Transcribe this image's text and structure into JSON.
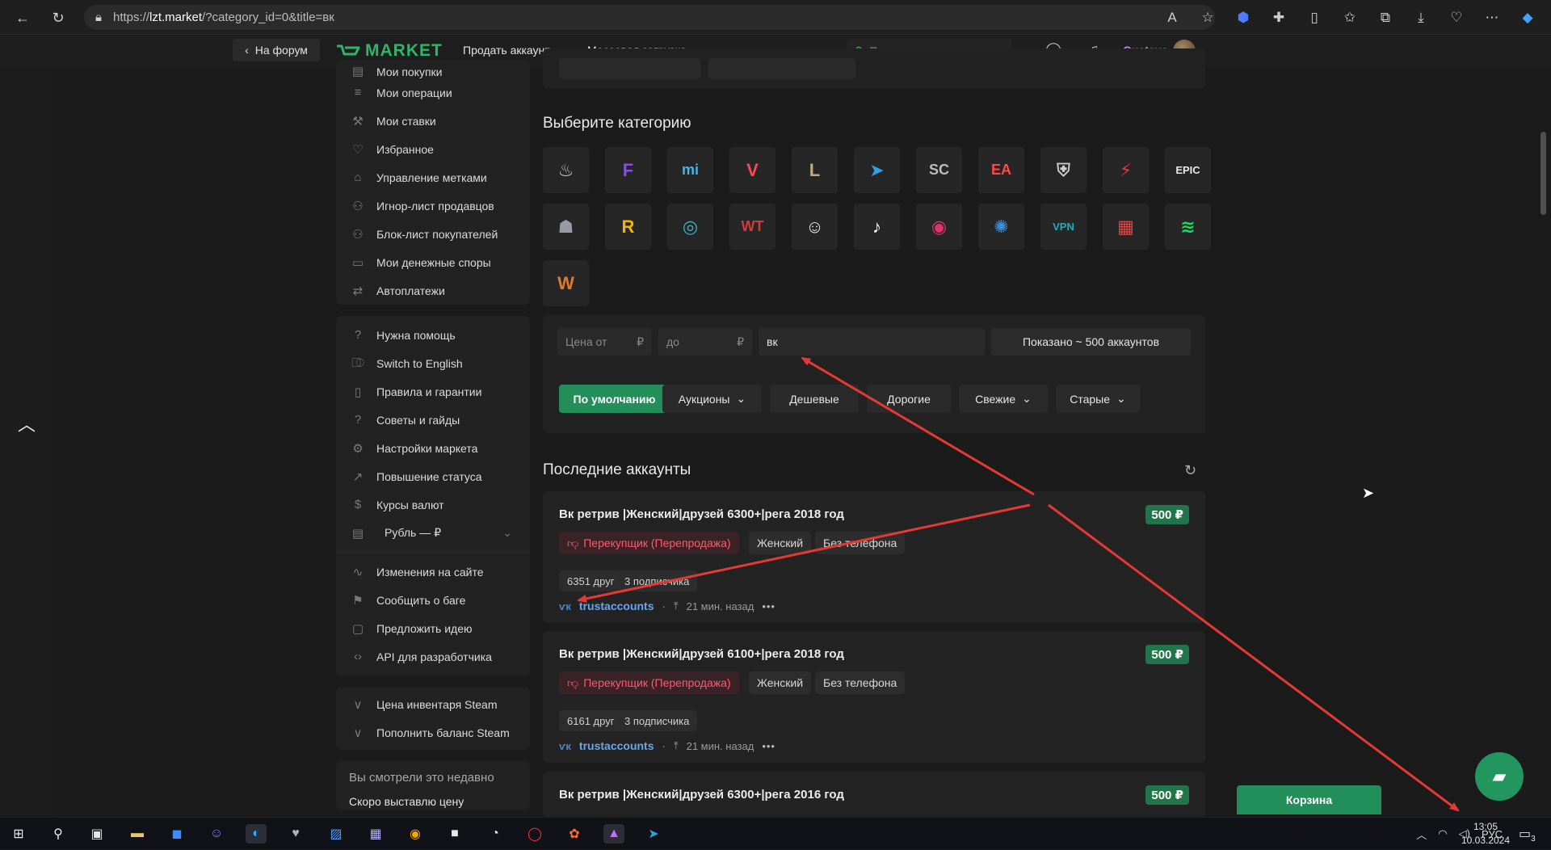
{
  "browser": {
    "url_prefix": "https://",
    "url_host": "lzt.market",
    "url_path": "/?category_id=0&title=вк"
  },
  "header": {
    "back_label": "На форум",
    "logo_text": "MARKET",
    "sell_label": "Продать аккаунт",
    "bulk_label": "Массовая загрузка",
    "search_placeholder": "Поиск...",
    "username": "Gustavo"
  },
  "sidebar": {
    "group1": [
      {
        "label": "Мои покупки",
        "icon": "bag-icon"
      },
      {
        "label": "Мои операции",
        "icon": "list-icon"
      },
      {
        "label": "Мои ставки",
        "icon": "gavel-icon"
      },
      {
        "label": "Избранное",
        "icon": "heart-icon"
      },
      {
        "label": "Управление метками",
        "icon": "tag-icon"
      },
      {
        "label": "Игнор-лист продавцов",
        "icon": "user-x-icon"
      },
      {
        "label": "Блок-лист покупателей",
        "icon": "user-block-icon"
      },
      {
        "label": "Мои денежные споры",
        "icon": "chat-icon"
      },
      {
        "label": "Автоплатежи",
        "icon": "repeat-icon"
      }
    ],
    "group2": [
      {
        "label": "Нужна помощь",
        "icon": "help-icon"
      },
      {
        "label": "Switch to English",
        "icon": "translate-icon"
      },
      {
        "label": "Правила и гарантии",
        "icon": "book-icon"
      },
      {
        "label": "Советы и гайды",
        "icon": "help-icon"
      },
      {
        "label": "Настройки маркета",
        "icon": "gear-icon"
      },
      {
        "label": "Повышение статуса",
        "icon": "trend-icon"
      },
      {
        "label": "Курсы валют",
        "icon": "dollar-icon"
      }
    ],
    "currency_label": "Рубль — ₽",
    "group3": [
      {
        "label": "Изменения на сайте",
        "icon": "pulse-icon"
      },
      {
        "label": "Сообщить о баге",
        "icon": "flag-icon"
      },
      {
        "label": "Предложить идею",
        "icon": "comment-icon"
      },
      {
        "label": "API для разработчика",
        "icon": "code-icon"
      }
    ],
    "group4": [
      {
        "label": "Цена инвентаря Steam",
        "icon": "steam-icon"
      },
      {
        "label": "Пополнить баланс Steam",
        "icon": "steam-icon"
      }
    ],
    "recent_heading": "Вы смотрели это недавно",
    "recent_item": "Скоро выставлю цену"
  },
  "categories": {
    "title": "Выберите категорию",
    "items": [
      {
        "name": "steam",
        "glyph": "♨",
        "color": "#c7c7c7"
      },
      {
        "name": "fortnite",
        "glyph": "F",
        "color": "#8b4fd6"
      },
      {
        "name": "mihoyo",
        "glyph": "mi",
        "color": "#3fb7e8"
      },
      {
        "name": "valorant",
        "glyph": "V",
        "color": "#ff4655"
      },
      {
        "name": "league-of-legends",
        "glyph": "L",
        "color": "#c8aa6e"
      },
      {
        "name": "telegram",
        "glyph": "➤",
        "color": "#2aa3e0"
      },
      {
        "name": "supercell",
        "glyph": "SC",
        "color": "#bdbdbd"
      },
      {
        "name": "ea",
        "glyph": "EA",
        "color": "#ff4747"
      },
      {
        "name": "world-of-tanks",
        "glyph": "⛨",
        "color": "#cfcfcf"
      },
      {
        "name": "wot-blitz",
        "glyph": "⚡",
        "color": "#e0394a"
      },
      {
        "name": "epic-games",
        "glyph": "EPIC",
        "color": "#e8e8e8"
      },
      {
        "name": "escape-from-tarkov",
        "glyph": "☗",
        "color": "#9a9aa6"
      },
      {
        "name": "rockstar",
        "glyph": "R",
        "color": "#f4b400"
      },
      {
        "name": "uplay",
        "glyph": "◎",
        "color": "#39b3c8"
      },
      {
        "name": "war-thunder",
        "glyph": "WT",
        "color": "#d33b3b"
      },
      {
        "name": "discord",
        "glyph": "☺",
        "color": "#e8e8e8"
      },
      {
        "name": "tiktok",
        "glyph": "♪",
        "color": "#ffffff"
      },
      {
        "name": "instagram",
        "glyph": "◉",
        "color": "#e1306c"
      },
      {
        "name": "chatgpt",
        "glyph": "✺",
        "color": "#3a8ed8"
      },
      {
        "name": "vpn",
        "glyph": "VPN",
        "color": "#2aa8b8"
      },
      {
        "name": "cinema",
        "glyph": "▦",
        "color": "#e04848"
      },
      {
        "name": "spotify",
        "glyph": "≋",
        "color": "#1ed760"
      },
      {
        "name": "battlenet",
        "glyph": "W",
        "color": "#e07a2a"
      }
    ]
  },
  "filters": {
    "price_from": "Цена от",
    "price_to": "до",
    "currency": "₽",
    "title_value": "вк",
    "shown_count": "Показано ~ 500 аккаунтов",
    "sort": [
      {
        "label": "По умолчанию",
        "active": true,
        "dropdown": false
      },
      {
        "label": "Аукционы",
        "active": false,
        "dropdown": true
      },
      {
        "label": "Дешевые",
        "active": false,
        "dropdown": false
      },
      {
        "label": "Дорогие",
        "active": false,
        "dropdown": false
      },
      {
        "label": "Свежие",
        "active": false,
        "dropdown": true
      },
      {
        "label": "Старые",
        "active": false,
        "dropdown": true
      }
    ]
  },
  "latest": {
    "title": "Последние аккаунты",
    "listings": [
      {
        "title": "Вк ретрив |Женский|друзей 6300+|рега 2018 год",
        "price": "500 ₽",
        "tags": [
          "Перекупщик (Перепродажа)",
          "Женский",
          "Без телефона"
        ],
        "stats": [
          "6351 друг",
          "3 подписчика"
        ],
        "seller": "trustaccounts",
        "time": "21 мин. назад"
      },
      {
        "title": "Вк ретрив |Женский|друзей 6100+|рега 2018 год",
        "price": "500 ₽",
        "tags": [
          "Перекупщик (Перепродажа)",
          "Женский",
          "Без телефона"
        ],
        "stats": [
          "6161 друг",
          "3 подписчика"
        ],
        "seller": "trustaccounts",
        "time": "21 мин. назад"
      },
      {
        "title": "Вк ретрив |Женский|друзей 6300+|рега 2016 год",
        "price": "500 ₽"
      }
    ]
  },
  "cart_label": "Корзина",
  "taskbar": {
    "lang": "РУС",
    "time": "13:05",
    "date": "10.03.2024",
    "notif_count": "3"
  },
  "colors": {
    "accent": "#228e5a",
    "logo": "#2fb56a",
    "price": "#22744b",
    "resell_tag": "#ff5a6e",
    "seller": "#6aa7ea",
    "username": "#c48bff",
    "annotation": "#e53935"
  }
}
